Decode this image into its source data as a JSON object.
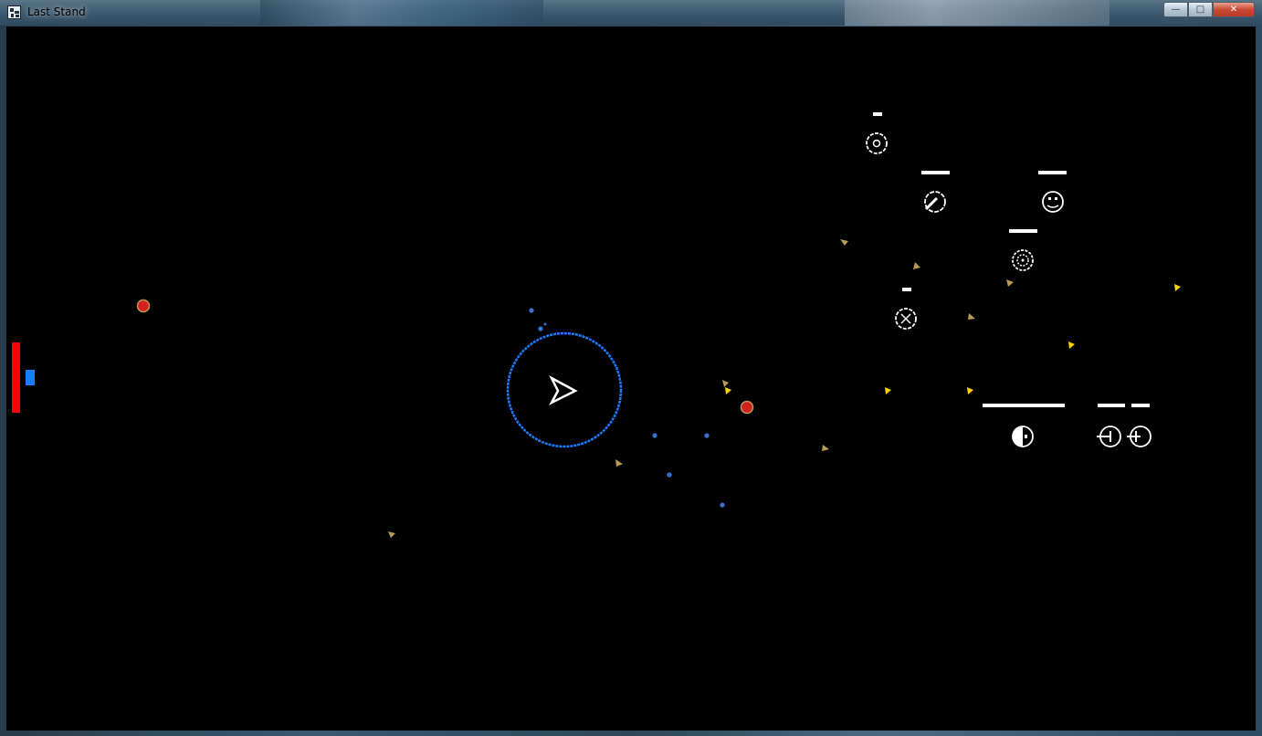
{
  "window": {
    "title": "Last Stand",
    "app_icon": "last-stand-app-icon",
    "controls": {
      "minimize": {
        "glyph": "—",
        "icon": "minimize-icon"
      },
      "maximize": {
        "glyph": "□",
        "icon": "maximize-icon"
      },
      "close": {
        "glyph": "✕",
        "icon": "close-icon"
      }
    }
  },
  "game": {
    "background": "#000000",
    "colors": {
      "health_bar": "#ff0000",
      "shield_bar": "#1a7cff",
      "player_ring": "#1a7cff",
      "player_ship": "#ffffff",
      "enemy_unit": "#ffffff",
      "enemy_health_bar": "#ffffff",
      "energy_orb": "#3a6fd8",
      "debris": "#b89a55",
      "ammo_pickup": "#ffd400",
      "red_orb": "#d42020"
    },
    "player_health": {
      "type": "health-bar"
    },
    "player_shield": {
      "type": "shield-bar"
    },
    "player": {
      "type": "player-ship",
      "icon": "triangle-ship-icon"
    },
    "enemies": [
      {
        "type": "target-enemy",
        "icon": "crosshair-icon"
      },
      {
        "type": "cannon-enemy",
        "icon": "cannon-icon"
      },
      {
        "type": "face-enemy",
        "icon": "face-icon"
      },
      {
        "type": "spinner-enemy",
        "icon": "spinner-icon"
      },
      {
        "type": "target-enemy",
        "icon": "crosshair-icon"
      },
      {
        "type": "half-moon-enemy",
        "icon": "half-moon-icon"
      },
      {
        "type": "plug-enemy",
        "icon": "plug-icon"
      },
      {
        "type": "plug-enemy",
        "icon": "plug-icon"
      }
    ],
    "red_orbs": 2,
    "energy_orbs": 7,
    "debris": 8,
    "ammo_pickups": 5
  }
}
